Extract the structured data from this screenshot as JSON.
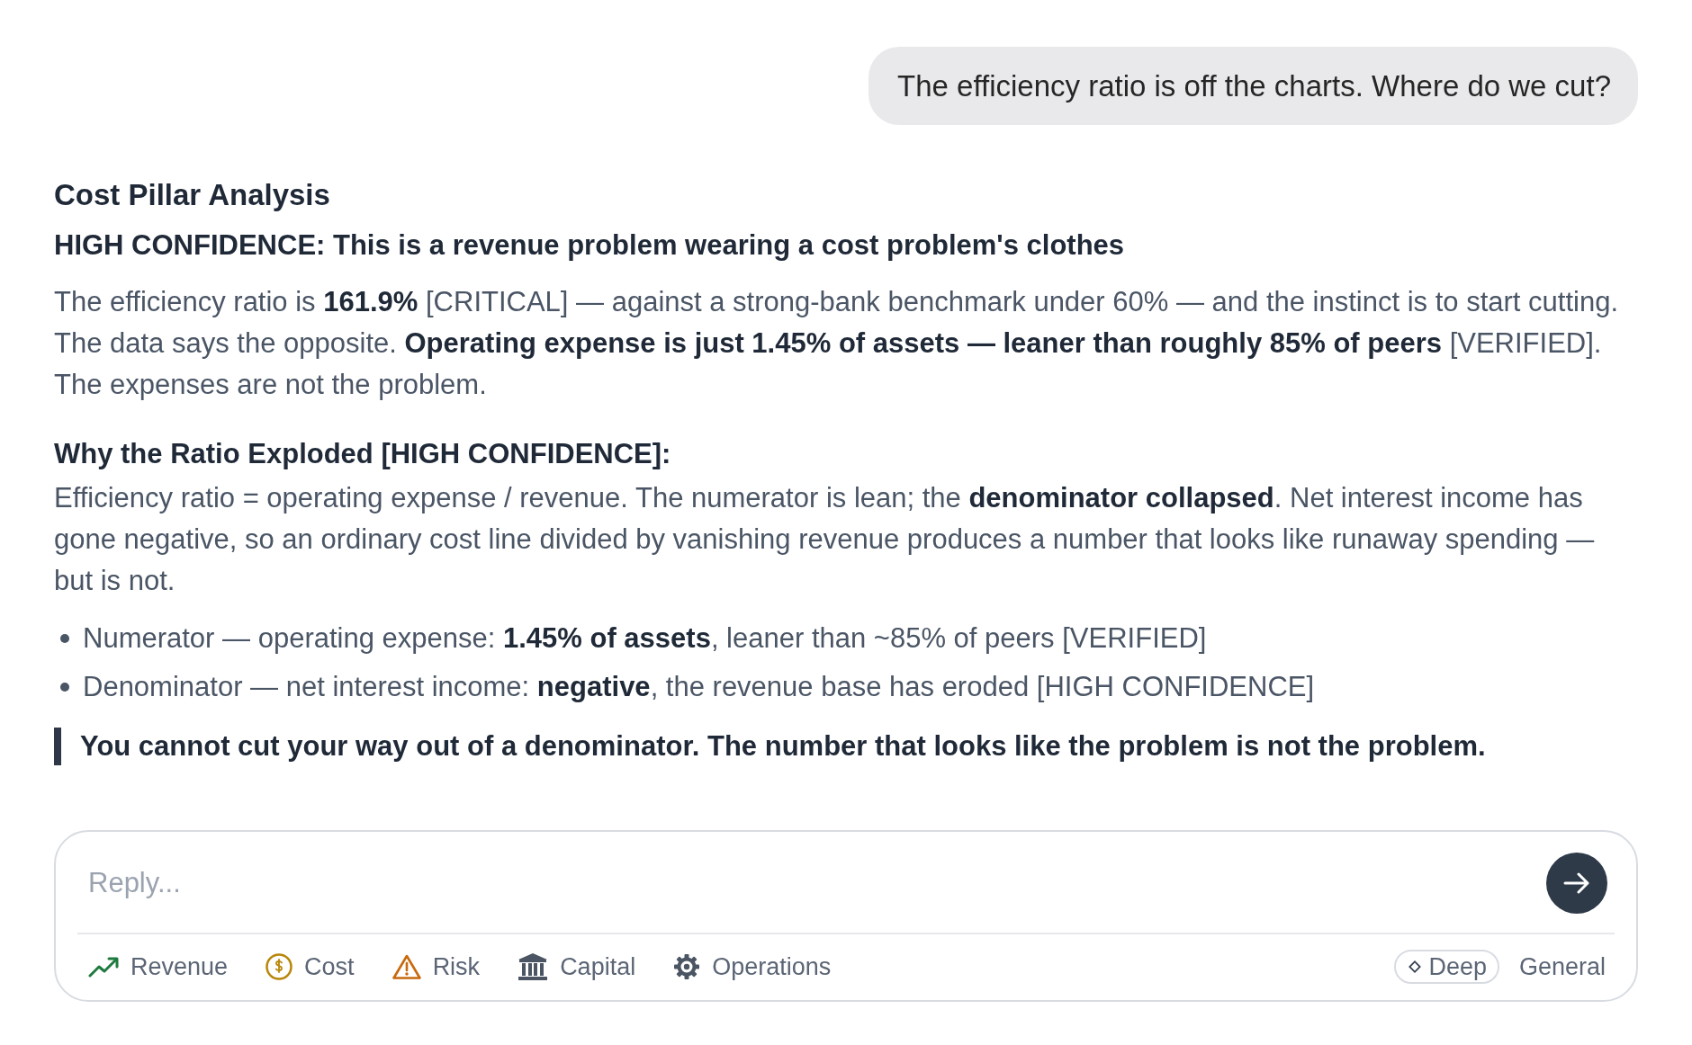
{
  "user_message": {
    "text": "The efficiency ratio is off the charts. Where do we cut?"
  },
  "response": {
    "title": "Cost Pillar Analysis",
    "headline": "HIGH CONFIDENCE: This is a revenue problem wearing a cost problem's clothes",
    "blocks": [
      {
        "kind": "paragraph",
        "text": "The efficiency ratio is **161.9%** [CRITICAL] — against a strong-bank benchmark under 60% — and the instinct is to start cutting. The data says the opposite. **Operating expense is just 1.45% of assets — leaner than roughly 85% of peers** [VERIFIED]. The expenses are not the problem."
      },
      {
        "kind": "subheading",
        "text": "Why the Ratio Exploded [HIGH CONFIDENCE]:"
      },
      {
        "kind": "paragraph",
        "text": "Efficiency ratio = operating expense / revenue. The numerator is lean; the **denominator collapsed**. Net interest income has gone negative, so an ordinary cost line divided by vanishing revenue produces a number that looks like runaway spending — but is not."
      },
      {
        "kind": "bullets",
        "items": [
          "Numerator — operating expense: **1.45% of assets**, leaner than ~85% of peers [VERIFIED]",
          "Denominator — net interest income: **negative**, the revenue base has eroded [HIGH CONFIDENCE]"
        ]
      },
      {
        "kind": "quote",
        "text": "You cannot cut your way out of a denominator. The number that looks like the problem is not the problem."
      }
    ]
  },
  "composer": {
    "placeholder": "Reply...",
    "pillars": [
      {
        "kind": "revenue",
        "label": "Revenue"
      },
      {
        "kind": "cost",
        "label": "Cost"
      },
      {
        "kind": "risk",
        "label": "Risk"
      },
      {
        "kind": "capital",
        "label": "Capital"
      },
      {
        "kind": "operations",
        "label": "Operations"
      }
    ],
    "depth_button": {
      "label": "Deep"
    },
    "scope_button": {
      "label": "General"
    }
  }
}
